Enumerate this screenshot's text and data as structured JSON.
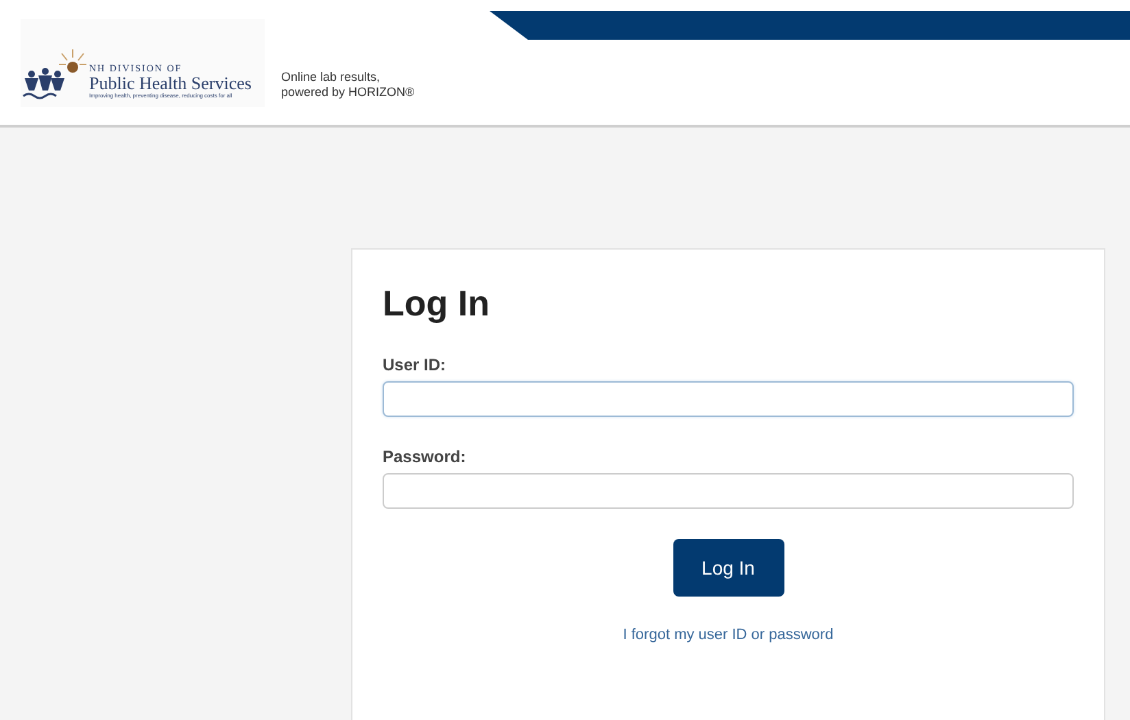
{
  "header": {
    "logo": {
      "line_1": "NH DIVISION OF",
      "line_2": "Public Health Services",
      "line_3": "Improving health, preventing disease, reducing costs for all"
    },
    "tagline": [
      "Online lab results,",
      "powered by HORIZON®"
    ]
  },
  "login": {
    "title": "Log In",
    "fields": [
      {
        "label": "User ID:",
        "focused": true
      },
      {
        "label": "Password:",
        "focused": false
      }
    ],
    "button": "Log In",
    "link": "I forgot my user ID or password"
  }
}
